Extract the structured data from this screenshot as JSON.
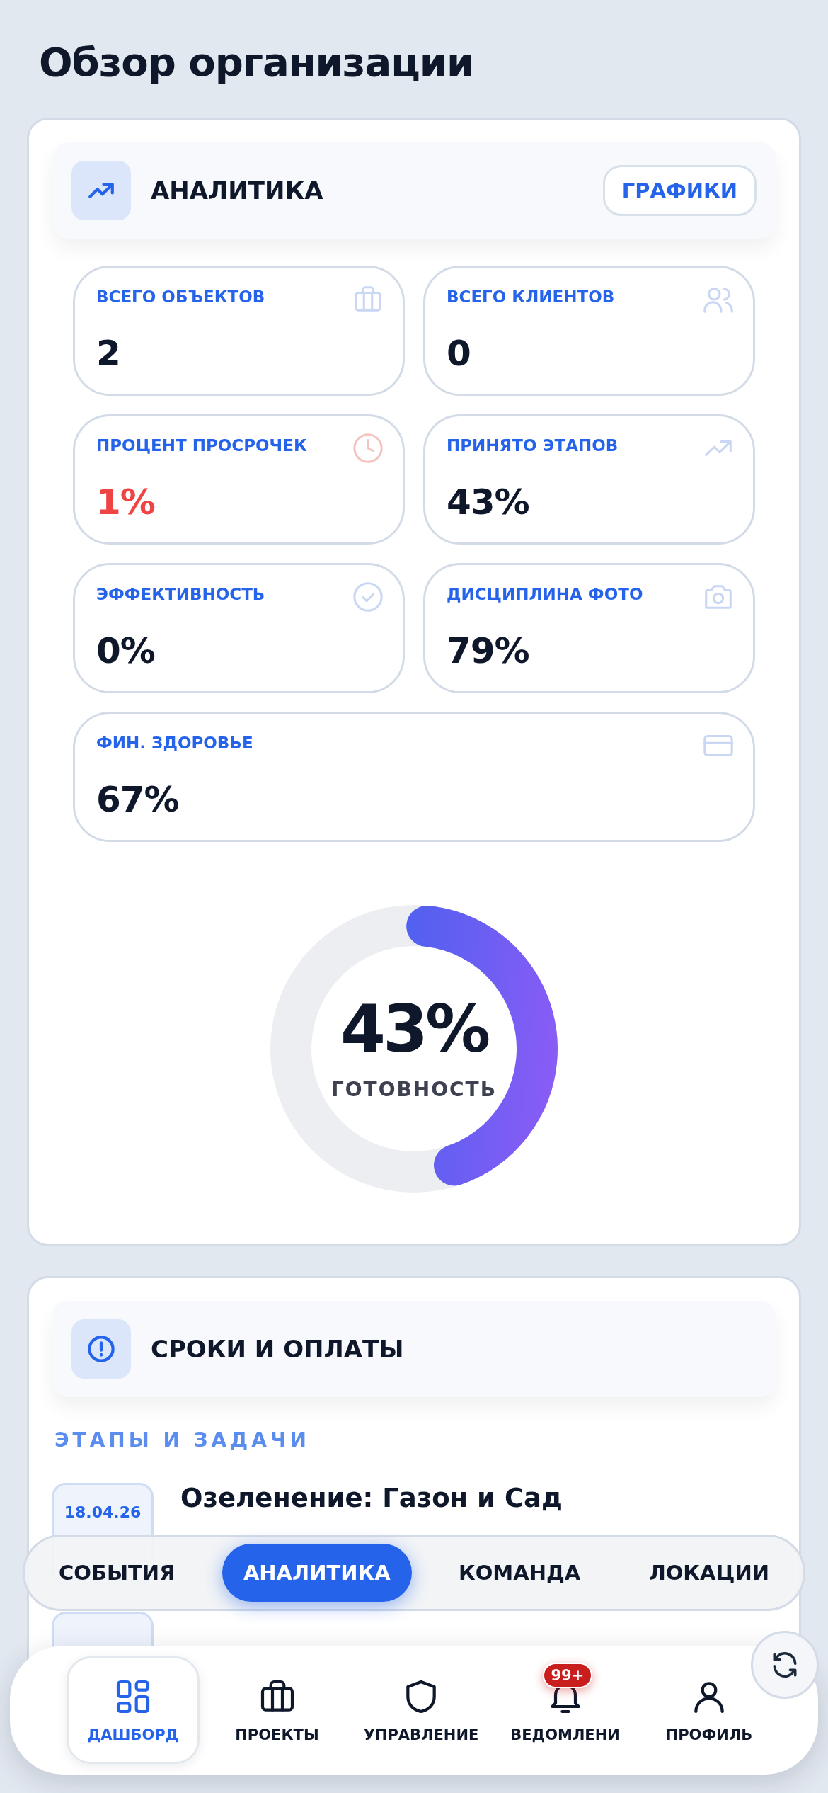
{
  "page_title": "Обзор организации",
  "analytics": {
    "title": "АНАЛИТИКА",
    "button": "ГРАФИКИ",
    "stats": [
      {
        "label": "ВСЕГО ОБЪЕКТОВ",
        "value": "2",
        "alert": false
      },
      {
        "label": "ВСЕГО КЛИЕНТОВ",
        "value": "0",
        "alert": false
      },
      {
        "label": "ПРОЦЕНТ ПРОСРОЧЕК",
        "value": "1%",
        "alert": true
      },
      {
        "label": "ПРИНЯТО ЭТАПОВ",
        "value": "43%",
        "alert": false
      },
      {
        "label": "ЭФФЕКТИВНОСТЬ",
        "value": "0%",
        "alert": false
      },
      {
        "label": "ДИСЦИПЛИНА ФОТО",
        "value": "79%",
        "alert": false
      },
      {
        "label": "ФИН. ЗДОРОВЬЕ",
        "value": "67%",
        "alert": false
      }
    ],
    "readiness": {
      "value": "43%",
      "label": "ГОТОВНОСТЬ",
      "level": 0.43
    }
  },
  "deadlines": {
    "title": "СРОКИ И ОПЛАТЫ",
    "section": "ЭТАПЫ И ЗАДАЧИ",
    "items": [
      {
        "date": "18.04.26",
        "title": "Озеленение: Газон и Сад"
      }
    ]
  },
  "tabs": [
    {
      "label": "СОБЫТИЯ",
      "selected": false
    },
    {
      "label": "АНАЛИТИКА",
      "selected": true
    },
    {
      "label": "КОМАНДА",
      "selected": false
    },
    {
      "label": "ЛОКАЦИИ",
      "selected": false
    }
  ],
  "nav": [
    {
      "label": "ДАШБОРД",
      "selected": true
    },
    {
      "label": "ПРОЕКТЫ",
      "selected": false
    },
    {
      "label": "УПРАВЛЕНИЕ",
      "selected": false
    },
    {
      "label": "ВЕДОМЛЕНИ",
      "selected": false,
      "badge": "99+"
    },
    {
      "label": "ПРОФИЛЬ",
      "selected": false
    }
  ]
}
